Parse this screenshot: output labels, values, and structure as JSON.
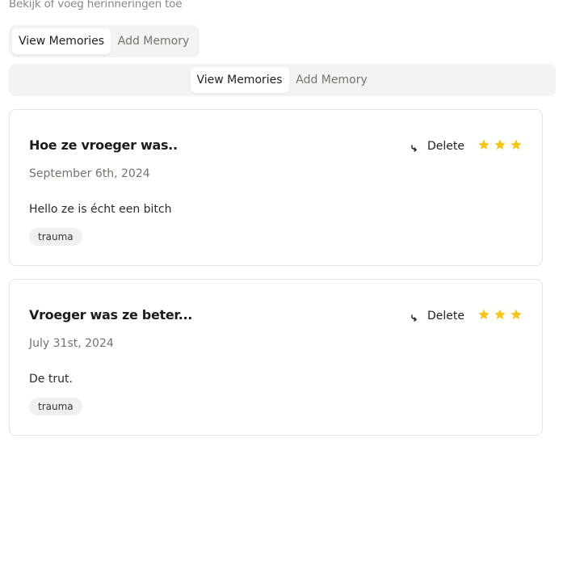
{
  "header": {
    "subtitle": "Bekijk of voeg herinneringen toe"
  },
  "tabs_top": {
    "view_label": "View Memories",
    "add_label": "Add Memory"
  },
  "tabs_main": {
    "view_label": "View Memories",
    "add_label": "Add Memory"
  },
  "memories": [
    {
      "title": "Hoe ze vroeger was..",
      "date": "September 6th, 2024",
      "content": "Hello ze is écht een bitch",
      "tag": "trauma",
      "delete_label": "Delete",
      "rating": 3
    },
    {
      "title": "Vroeger was ze beter...",
      "date": "July 31st, 2024",
      "content": "De trut.",
      "tag": "trauma",
      "delete_label": "Delete",
      "rating": 3
    }
  ],
  "colors": {
    "star": "#f5c518",
    "tab_background": "#f4f3f1",
    "card_border": "#e6e4e1"
  }
}
